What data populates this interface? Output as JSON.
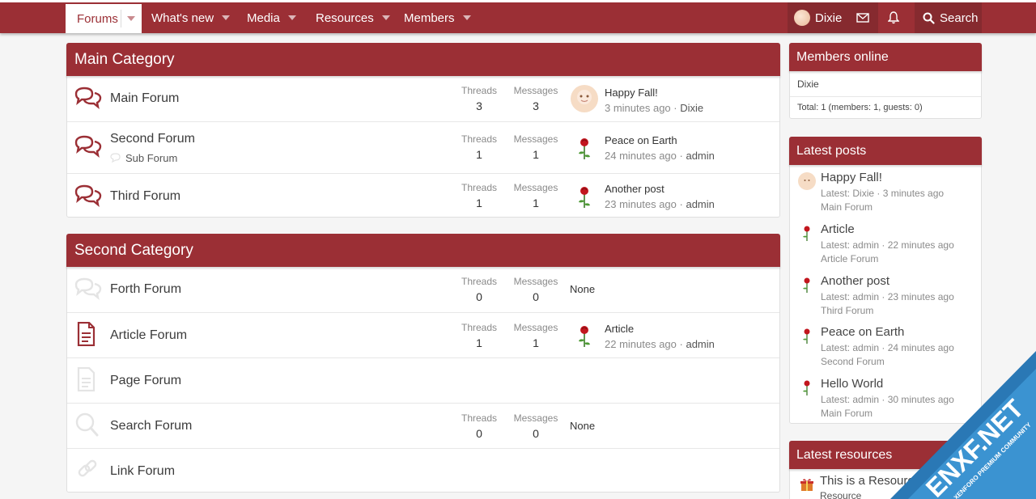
{
  "nav": {
    "tabs": [
      {
        "label": "Forums"
      },
      {
        "label": "What's new"
      },
      {
        "label": "Media"
      },
      {
        "label": "Resources"
      },
      {
        "label": "Members"
      }
    ],
    "user": "Dixie",
    "search_label": "Search"
  },
  "colors": {
    "brand": "#9b2f35",
    "brand_dark": "#862a2f",
    "background": "#f5f5f5"
  },
  "categories": [
    {
      "title": "Main Category",
      "forums": [
        {
          "name": "Main Forum",
          "threads_label": "Threads",
          "messages_label": "Messages",
          "threads": "3",
          "messages": "3",
          "last_title": "Happy Fall!",
          "last_time": "3 minutes ago",
          "last_user": "Dixie"
        },
        {
          "name": "Second Forum",
          "sub": "Sub Forum",
          "threads_label": "Threads",
          "messages_label": "Messages",
          "threads": "1",
          "messages": "1",
          "last_title": "Peace on Earth",
          "last_time": "24 minutes ago",
          "last_user": "admin"
        },
        {
          "name": "Third Forum",
          "threads_label": "Threads",
          "messages_label": "Messages",
          "threads": "1",
          "messages": "1",
          "last_title": "Another post",
          "last_time": "23 minutes ago",
          "last_user": "admin"
        }
      ]
    },
    {
      "title": "Second Category",
      "forums": [
        {
          "name": "Forth Forum",
          "threads_label": "Threads",
          "messages_label": "Messages",
          "threads": "0",
          "messages": "0",
          "none": "None"
        },
        {
          "name": "Article Forum",
          "threads_label": "Threads",
          "messages_label": "Messages",
          "threads": "1",
          "messages": "1",
          "last_title": "Article",
          "last_time": "22 minutes ago",
          "last_user": "admin"
        },
        {
          "name": "Page Forum"
        },
        {
          "name": "Search Forum",
          "threads_label": "Threads",
          "messages_label": "Messages",
          "threads": "0",
          "messages": "0",
          "none": "None"
        },
        {
          "name": "Link Forum"
        }
      ]
    }
  ],
  "sidebar": {
    "members_online": {
      "title": "Members online",
      "member": "Dixie",
      "total": "Total: 1 (members: 1, guests: 0)"
    },
    "latest_posts": {
      "title": "Latest posts",
      "items": [
        {
          "title": "Happy Fall!",
          "meta": "Latest: Dixie · 3 minutes ago",
          "forum": "Main Forum"
        },
        {
          "title": "Article",
          "meta": "Latest: admin · 22 minutes ago",
          "forum": "Article Forum"
        },
        {
          "title": "Another post",
          "meta": "Latest: admin · 23 minutes ago",
          "forum": "Third Forum"
        },
        {
          "title": "Peace on Earth",
          "meta": "Latest: admin · 24 minutes ago",
          "forum": "Second Forum"
        },
        {
          "title": "Hello World",
          "meta": "Latest: admin · 30 minutes ago",
          "forum": "Main Forum"
        }
      ]
    },
    "latest_resources": {
      "title": "Latest resources",
      "item_title": "This is a Resource",
      "item_sub": "Resource"
    }
  },
  "watermark": {
    "brand": "ENXF.NET",
    "tagline": "XENFORO PREMIUM COMMUNITY"
  },
  "separator": " · "
}
